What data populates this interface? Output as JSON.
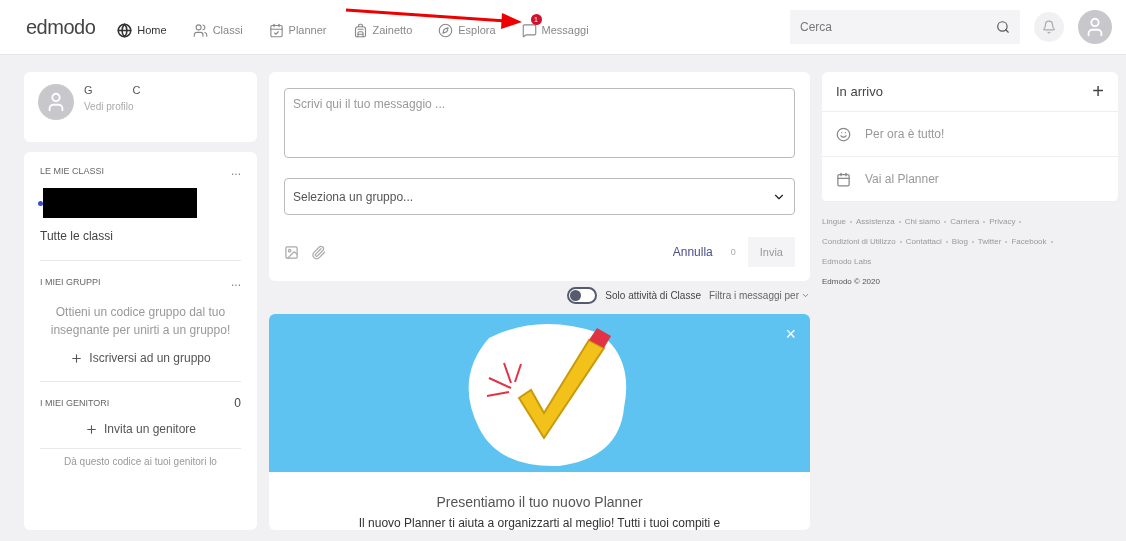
{
  "header": {
    "logo": "edmodo",
    "nav": [
      {
        "label": "Home",
        "selected": true
      },
      {
        "label": "Classi",
        "selected": false
      },
      {
        "label": "Planner",
        "selected": false
      },
      {
        "label": "Zainetto",
        "selected": false
      },
      {
        "label": "Esplora",
        "selected": false
      },
      {
        "label": "Messaggi",
        "selected": false,
        "badge": "1"
      }
    ],
    "search": {
      "placeholder": "Cerca"
    }
  },
  "profile": {
    "name_parts": [
      "G",
      "C"
    ],
    "link": "Vedi profilo"
  },
  "classes": {
    "title": "LE MIE CLASSI",
    "menu": "...",
    "all": "Tutte le classi"
  },
  "groups": {
    "title": "I MIEI GRUPPI",
    "menu": "...",
    "hint": "Ottieni un codice gruppo dal tuo insegnante per unirti a un gruppo!",
    "action": "Iscriversi ad un gruppo"
  },
  "parents": {
    "title": "I MIEI GENITORI",
    "count": "0",
    "action": "Invita un genitore",
    "note": "Dà questo codice ai tuoi genitori lo"
  },
  "composer": {
    "placeholder": "Scrivi qui il tuo messaggio ...",
    "group_placeholder": "Seleziona un gruppo...",
    "cancel": "Annulla",
    "counter": "0",
    "send": "Invia"
  },
  "filter": {
    "toggle_label": "Solo attività di Classe",
    "toggle_on": false,
    "menu": "Filtra i messaggi per"
  },
  "promo": {
    "close": "×",
    "title": "Presentiamo il tuo nuovo Planner",
    "body": "Il nuovo Planner ti aiuta a organizzarti al meglio! Tutti i tuoi compiti e"
  },
  "upcoming": {
    "title": "In arrivo",
    "add": "+",
    "items": [
      {
        "label": "Per ora è tutto!"
      },
      {
        "label": "Vai al Planner"
      }
    ]
  },
  "footer": {
    "links": [
      "Lingue",
      "Assistenza",
      "Chi siamo",
      "Carriera",
      "Privacy",
      "Condizioni di Utilizzo",
      "Contattaci",
      "Blog",
      "Twitter",
      "Facebook",
      "Edmodo Labs"
    ],
    "copyright": "Edmodo © 2020"
  }
}
